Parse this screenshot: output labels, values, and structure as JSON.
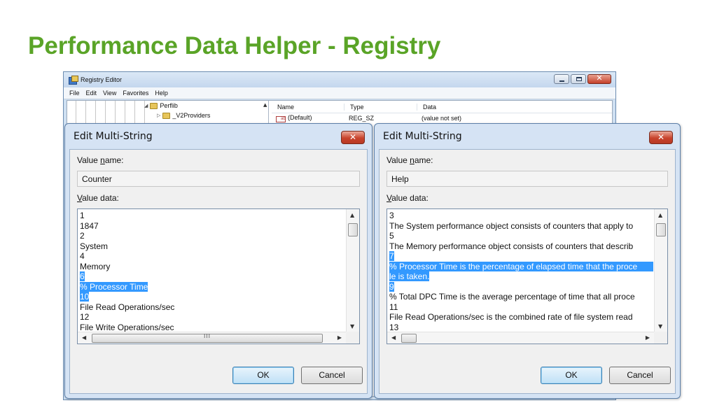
{
  "slide": {
    "title": "Performance Data Helper - Registry"
  },
  "registry_editor": {
    "title": "Registry Editor",
    "menu": [
      "File",
      "Edit",
      "View",
      "Favorites",
      "Help"
    ],
    "tree": [
      {
        "label": "Perflib",
        "expanded": true
      },
      {
        "label": "_V2Providers",
        "expanded": false
      }
    ],
    "columns": [
      "Name",
      "Type",
      "Data"
    ],
    "rows": [
      {
        "name": "(Default)",
        "type": "REG_SZ",
        "data": "(value not set)"
      }
    ],
    "icons": {
      "app": "registry-editor-icon",
      "folder": "folder-icon"
    }
  },
  "dialogs": [
    {
      "title": "Edit Multi-String",
      "value_name_label_pre": "Value ",
      "value_name_label_ul": "n",
      "value_name_label_post": "ame:",
      "value_name": "Counter",
      "value_data_label_ul": "V",
      "value_data_label_post": "alue data:",
      "lines": [
        {
          "text": "1",
          "selected": false
        },
        {
          "text": "1847",
          "selected": false
        },
        {
          "text": "2",
          "selected": false
        },
        {
          "text": "System",
          "selected": false
        },
        {
          "text": "4",
          "selected": false
        },
        {
          "text": "Memory",
          "selected": false
        },
        {
          "text": "6",
          "selected": true
        },
        {
          "text": "% Processor Time",
          "selected": true
        },
        {
          "text": "10",
          "selected": true
        },
        {
          "text": "File Read Operations/sec",
          "selected": false
        },
        {
          "text": "12",
          "selected": false
        },
        {
          "text": "File Write Operations/sec",
          "selected": false
        }
      ],
      "hscroll_grip": "III",
      "ok_label": "OK",
      "cancel_label": "Cancel"
    },
    {
      "title": "Edit Multi-String",
      "value_name_label_pre": "Value ",
      "value_name_label_ul": "n",
      "value_name_label_post": "ame:",
      "value_name": "Help",
      "value_data_label_ul": "V",
      "value_data_label_post": "alue data:",
      "lines": [
        {
          "text": "3",
          "selected": false
        },
        {
          "text": "The System performance object consists of counters that apply to",
          "selected": false
        },
        {
          "text": "5",
          "selected": false
        },
        {
          "text": "The Memory performance object  consists of counters that describ",
          "selected": false
        },
        {
          "text": "7",
          "selected": true
        },
        {
          "text": "% Processor Time is the percentage of elapsed time that the proce",
          "selected": true
        },
        {
          "text": "le is taken.",
          "selected": true
        },
        {
          "text": "9",
          "selected": true
        },
        {
          "text": "% Total DPC Time is the average percentage of time that all proce",
          "selected": false
        },
        {
          "text": "11",
          "selected": false
        },
        {
          "text": "File Read Operations/sec is the combined rate of file system read",
          "selected": false
        },
        {
          "text": "13",
          "selected": false
        }
      ],
      "hscroll_grip": "",
      "ok_label": "OK",
      "cancel_label": "Cancel"
    }
  ],
  "colors": {
    "title_green": "#5aa427",
    "selection_blue": "#3399ff",
    "close_red": "#c8432c"
  }
}
